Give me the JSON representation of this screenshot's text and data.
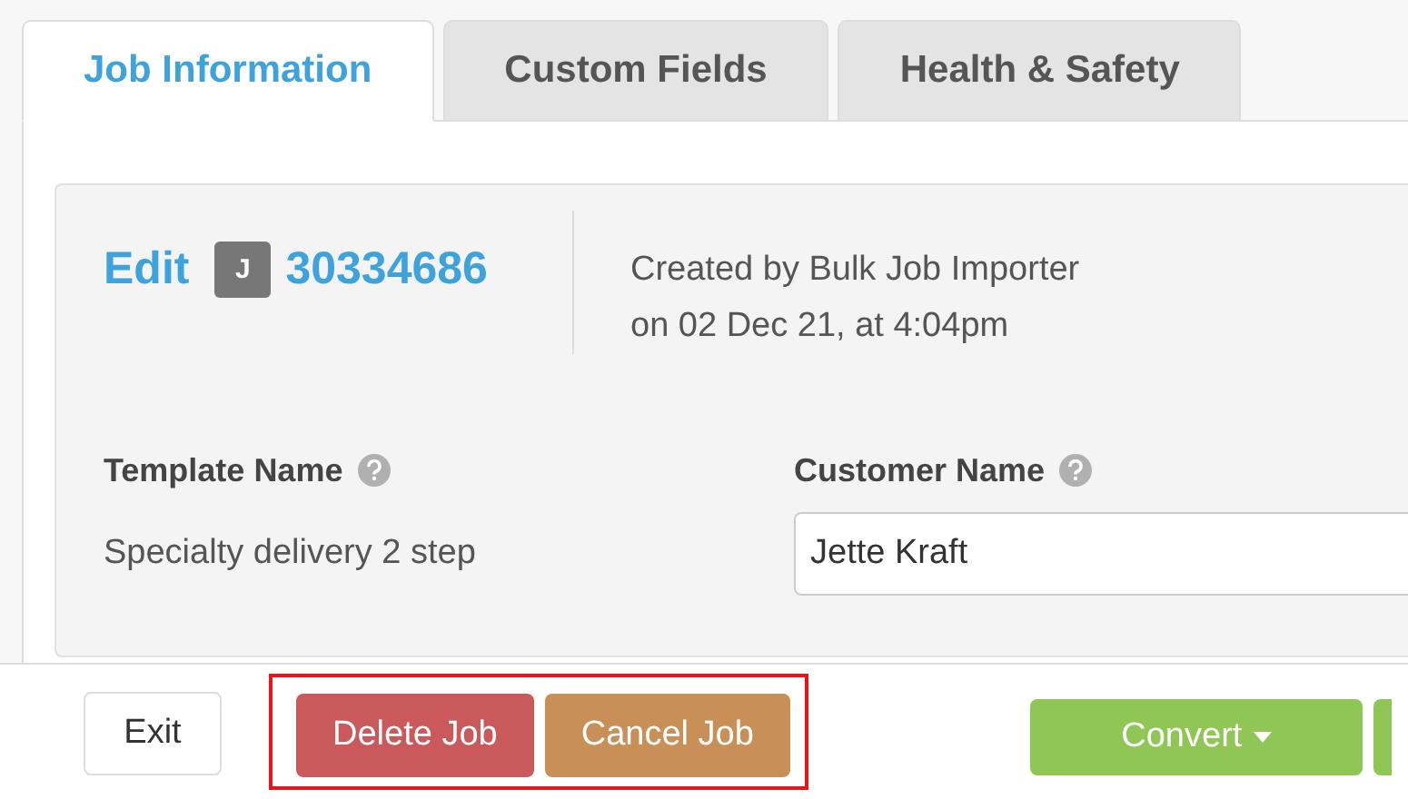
{
  "tabs": [
    {
      "label": "Job Information",
      "selected": true
    },
    {
      "label": "Custom Fields",
      "selected": false
    },
    {
      "label": "Health & Safety",
      "selected": false
    }
  ],
  "job": {
    "edit_label": "Edit",
    "badge": "J",
    "number": "30334686",
    "created_lines": [
      "Created by Bulk Job Importer",
      "on 02 Dec 21, at 4:04pm"
    ]
  },
  "fields": [
    {
      "label": "Template Name",
      "kind": "text",
      "value": "Specialty delivery 2 step"
    },
    {
      "label": "Customer Name",
      "kind": "input",
      "value": "Jette Kraft"
    }
  ],
  "footer": {
    "exit": "Exit",
    "highlighted_buttons": [
      {
        "label": "Delete Job",
        "kind": "delete"
      },
      {
        "label": "Cancel Job",
        "kind": "cancel"
      }
    ],
    "convert": "Convert"
  }
}
